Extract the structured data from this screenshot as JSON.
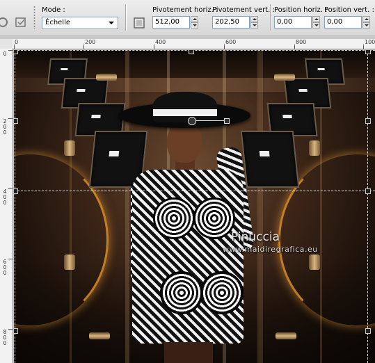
{
  "toolbar": {
    "mode_label": "Mode :",
    "mode_value": "Échelle",
    "pivot_h_label": "Pivotement horiz. :",
    "pivot_h_value": "512,00",
    "pivot_v_label": "Pivotement vert. :",
    "pivot_v_value": "202,50",
    "pos_h_label": "Position horiz. :",
    "pos_h_value": "0,00",
    "pos_v_label": "Position vert. :",
    "pos_v_value": "0,00"
  },
  "ruler_top": [
    "0",
    "200",
    "400",
    "600",
    "800",
    "100"
  ],
  "ruler_left": [
    "0",
    "2\n0\n0",
    "4\n0\n0",
    "6\n0\n0",
    "8\n0\n0"
  ],
  "canvas": {
    "watermark_name": "Pinuccia",
    "watermark_url": "www.maidiregrafica.eu"
  },
  "colors": {
    "accent_glow": "#e69628",
    "canvas_dark": "#1b110b"
  }
}
